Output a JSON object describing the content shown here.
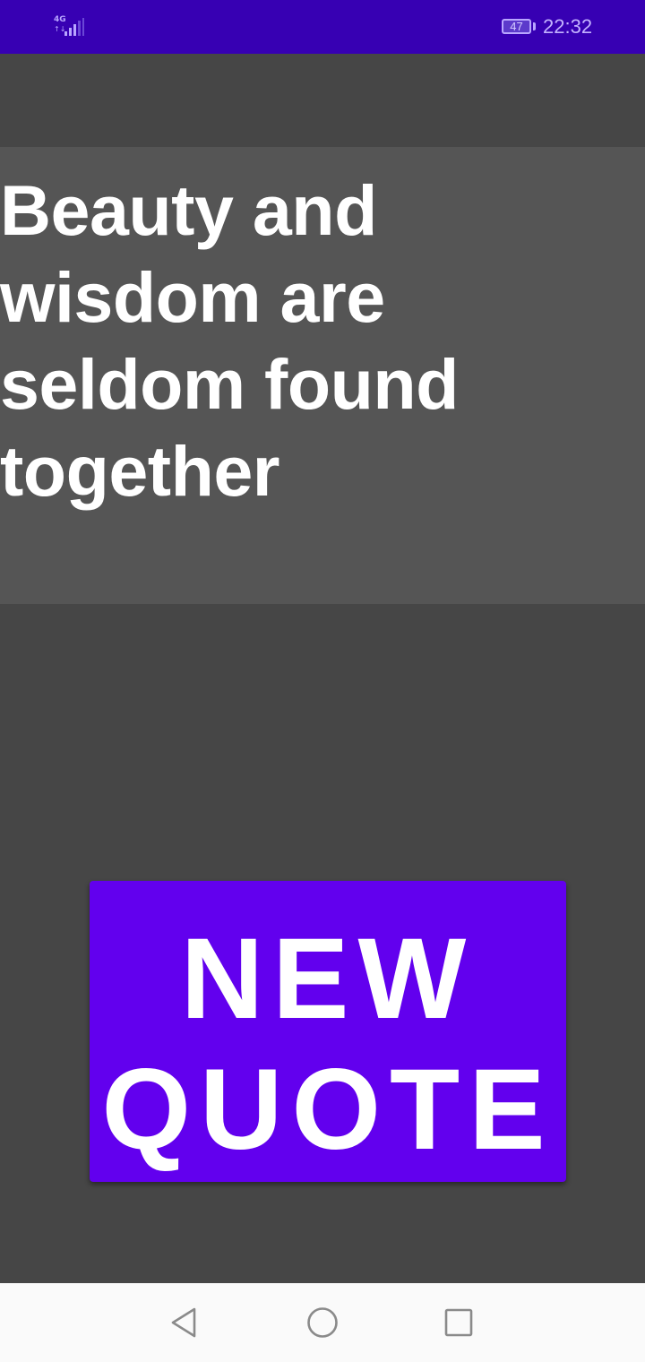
{
  "status_bar": {
    "network_type": "4G",
    "data_arrows": "↑↓",
    "battery_level": "47",
    "time": "22:32",
    "colors": {
      "background": "#3700b3",
      "foreground": "#b9a6ff"
    },
    "icons": {
      "signal": "cellular-signal-icon",
      "battery": "battery-icon"
    }
  },
  "quote": {
    "text": "Beauty and wisdom are seldom found together"
  },
  "new_quote_button": {
    "line1": "NEW",
    "line2": "QUOTE",
    "color": "#6200ee"
  },
  "navigation_bar": {
    "icons": {
      "back": "back-triangle-icon",
      "home": "home-circle-icon",
      "recents": "recents-square-icon"
    }
  },
  "colors": {
    "app_background": "#464646",
    "quote_panel": "#555555",
    "text": "#ffffff",
    "nav_background": "#fafafa"
  }
}
